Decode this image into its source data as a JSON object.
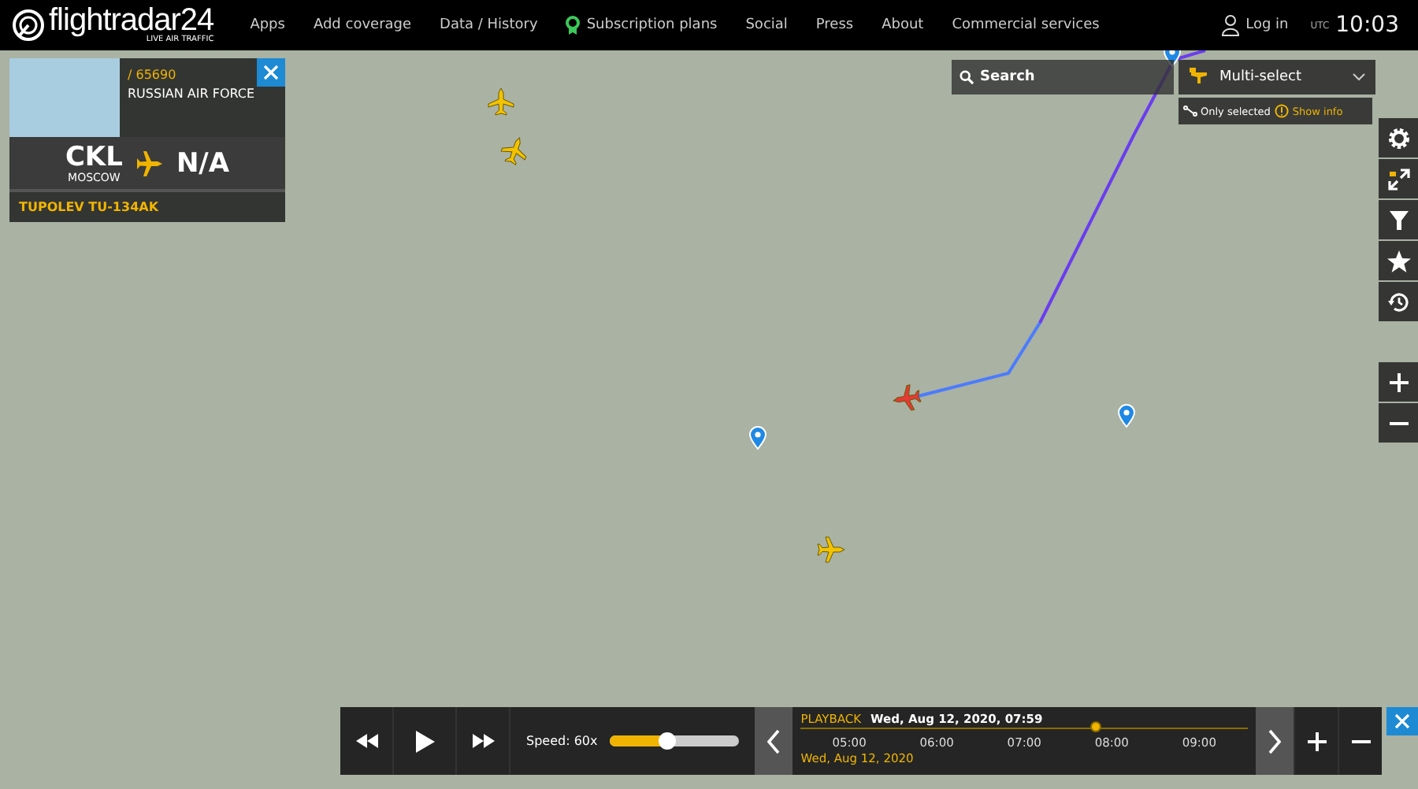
{
  "header": {
    "logo": {
      "name": "flightradar24",
      "tagline": "LIVE AIR TRAFFIC"
    },
    "nav": [
      {
        "label": "Apps",
        "kind": "text"
      },
      {
        "label": "Add coverage",
        "kind": "text"
      },
      {
        "label": "Data / History",
        "kind": "text"
      },
      {
        "label": "Subscription plans",
        "kind": "award"
      },
      {
        "label": "Social",
        "kind": "text"
      },
      {
        "label": "Press",
        "kind": "text"
      },
      {
        "label": "About",
        "kind": "text"
      },
      {
        "label": "Commercial services",
        "kind": "text"
      }
    ],
    "login": "Log in",
    "utc_label": "UTC",
    "time": "10:03"
  },
  "flight_panel": {
    "registration": "/ 65690",
    "operator": "RUSSIAN AIR FORCE",
    "origin": "CKL",
    "origin_city": "MOSCOW",
    "destination": "N/A",
    "aircraft": "TUPOLEV TU-134AK"
  },
  "search": {
    "placeholder": "Search"
  },
  "multi_select": {
    "label": "Multi-select",
    "only_selected": "Only selected",
    "show_info": "Show info"
  },
  "playback": {
    "speed": "Speed: 60x",
    "level": 0.44,
    "label": "PLAYBACK",
    "datetime": "Wed, Aug 12, 2020, 07:59",
    "ticks": [
      "05:00",
      "06:00",
      "07:00",
      "08:00",
      "09:00"
    ],
    "timeline": {
      "level": 0.66
    },
    "date": "Wed, Aug 12, 2020"
  }
}
